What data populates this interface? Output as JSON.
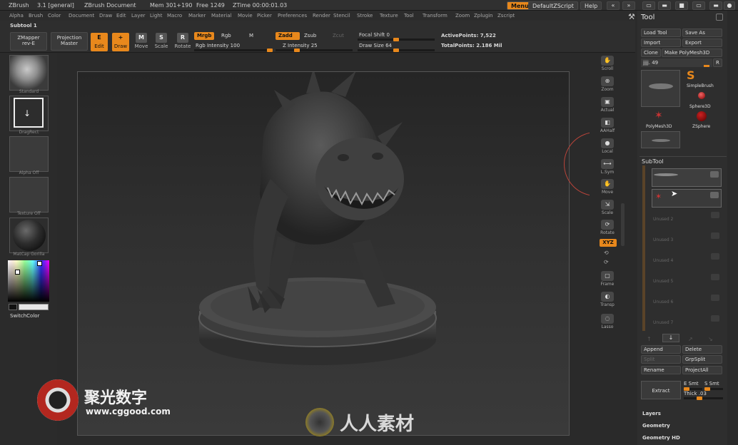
{
  "titlebar": {
    "app": "ZBrush",
    "version": "3.1 [general]",
    "document": "ZBrush Document",
    "mem": "Mem 301+190",
    "free": "Free 1249",
    "ztime": "ZTime 00:00:01.03",
    "menus_btn": "Menus",
    "script_btn": "DefaultZScript",
    "help_btn": "Help"
  },
  "menubar": [
    "Alpha",
    "Brush",
    "Color",
    "Document",
    "Draw",
    "Edit",
    "Layer",
    "Light",
    "Macro",
    "Marker",
    "Material",
    "Movie",
    "Picker",
    "Preferences",
    "Render",
    "Stencil",
    "Stroke",
    "Texture",
    "Tool",
    "Transform",
    "Zoom",
    "Zplugin",
    "Zscript"
  ],
  "shelf": {
    "subtool_label": "Subtool 1",
    "zmapper": "ZMapper",
    "zmapper_sub": "rev-E",
    "projection": "Projection",
    "projection_sub": "Master",
    "tools": [
      {
        "glyph": "E",
        "label": "Edit"
      },
      {
        "glyph": "+",
        "label": "Draw"
      },
      {
        "glyph": "M",
        "label": "Move"
      },
      {
        "glyph": "S",
        "label": "Scale"
      },
      {
        "glyph": "R",
        "label": "Rotate"
      }
    ],
    "mrgb": "Mrgb",
    "rgb": "Rgb",
    "m": "M",
    "rgb_intensity": "Rgb Intensity 100",
    "zadd": "Zadd",
    "zsub": "Zsub",
    "zcut": "Zcut",
    "z_intensity": "Z Intensity 25",
    "focal_shift": "Focal Shift 0",
    "draw_size": "Draw Size 64",
    "active_points": "ActivePoints: 7,522",
    "total_points": "TotalPoints: 2.186 Mil"
  },
  "left": {
    "standard": "Standard",
    "dragrect": "DragRect",
    "alpha_off": "Alpha Off",
    "texture_off": "Texture Off",
    "matcap": "MatCap Gorilla",
    "switch_color": "SwitchColor"
  },
  "rightstrip": [
    {
      "glyph": "✋",
      "label": "Scroll"
    },
    {
      "glyph": "⊕",
      "label": "Zoom"
    },
    {
      "glyph": "▣",
      "label": "Actual"
    },
    {
      "glyph": "◧",
      "label": "AAHalf"
    },
    {
      "glyph": "●",
      "label": "Local"
    },
    {
      "glyph": "⟷",
      "label": "L.Sym"
    },
    {
      "glyph": "✋",
      "label": "Move"
    },
    {
      "glyph": "⇲",
      "label": "Scale"
    },
    {
      "glyph": "⟳",
      "label": "Rotate"
    }
  ],
  "rightstrip_xyz": "XYZ",
  "rightstrip_lower": [
    {
      "glyph": "▢",
      "label": "Frame"
    },
    {
      "glyph": "◐",
      "label": "Transp"
    },
    {
      "glyph": "◌",
      "label": "Lasso"
    }
  ],
  "toolpal": {
    "title": "Tool",
    "load_tool": "Load Tool",
    "save_as": "Save As",
    "import": "Import",
    "export": "Export",
    "clone": "Clone",
    "make_polymesh": "Make PolyMesh3D",
    "slider_label": "jjjj. 49",
    "r": "R",
    "brushes": [
      "SimpleBrush",
      "Sphere3D",
      "PolyMesh3D",
      "ZSphere"
    ],
    "subtool_title": "SubTool",
    "unused": [
      "Unused 2",
      "Unused 3",
      "Unused 4",
      "Unused 5",
      "Unused 6",
      "Unused 7"
    ],
    "append": "Append",
    "delete": "Delete",
    "split": "Split",
    "grpsplit": "GrpSplit",
    "rename": "Rename",
    "projectall": "ProjectAll",
    "extract": "Extract",
    "esmt": "E Smt",
    "ssmt": "S Smt",
    "thick": "Thick .03",
    "layers": "Layers",
    "geometry": "Geometry",
    "geometry_hd": "Geometry HD"
  },
  "watermark": {
    "cn_brand": "聚光数字",
    "url": "www.cggood.com",
    "cn_site": "人人素材"
  },
  "colors": {
    "accent": "#e8881c"
  }
}
